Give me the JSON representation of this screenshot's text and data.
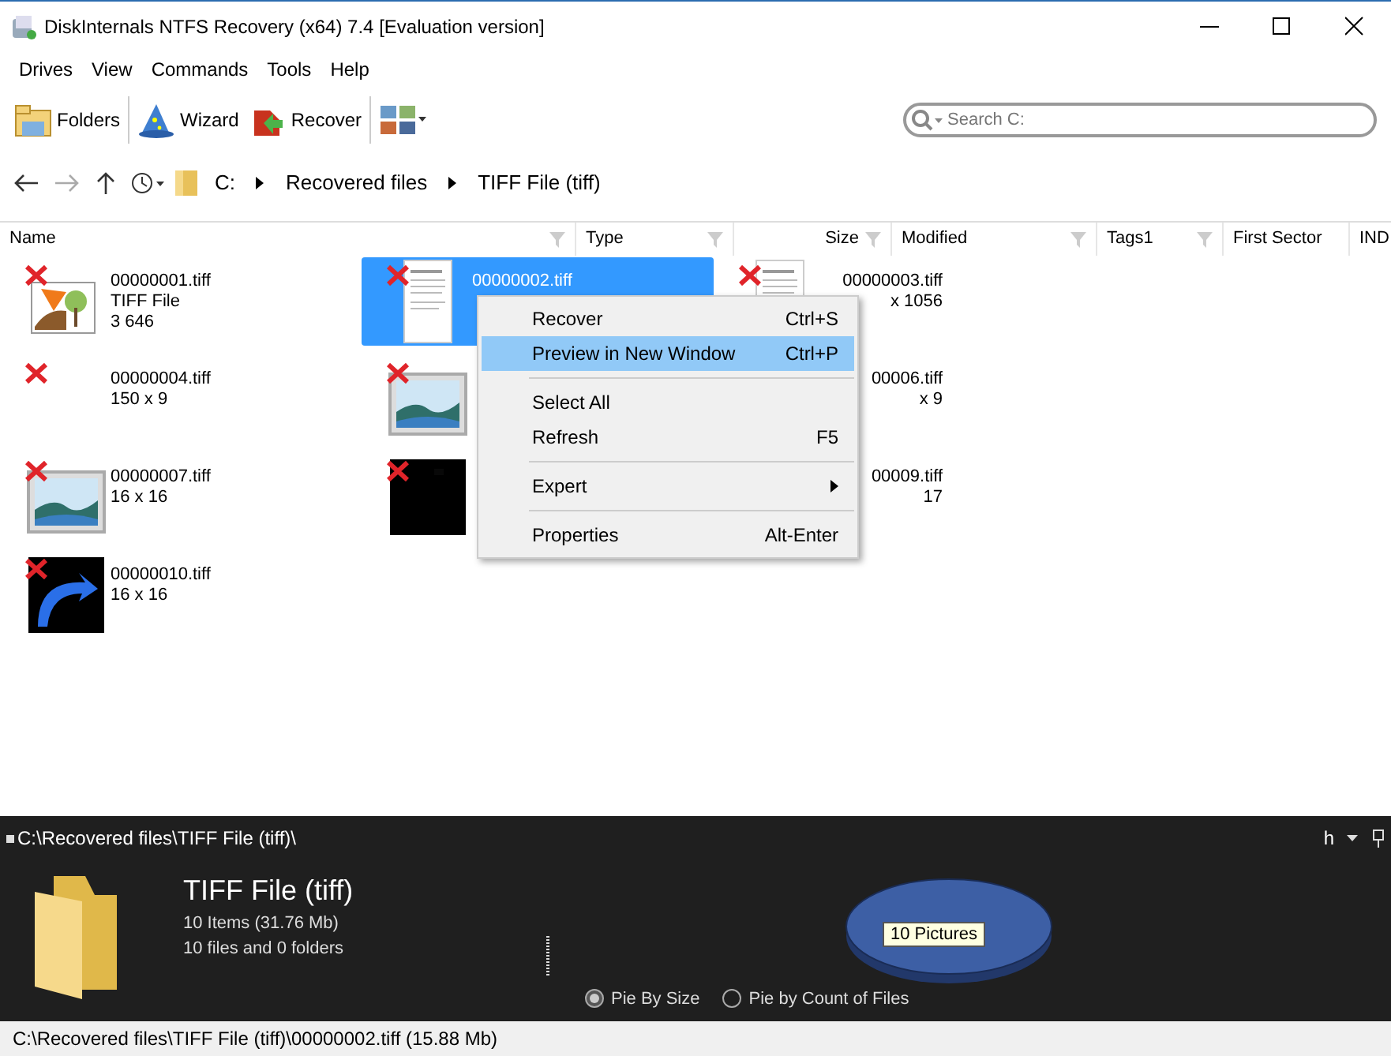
{
  "window": {
    "title": "DiskInternals NTFS Recovery (x64) 7.4 [Evaluation version]"
  },
  "menu_bar": [
    "Drives",
    "View",
    "Commands",
    "Tools",
    "Help"
  ],
  "toolbar": [
    {
      "label": "Folders",
      "kind": "folders"
    },
    {
      "label": "Wizard",
      "kind": "wizard"
    },
    {
      "label": "Recover",
      "kind": "recover"
    },
    {
      "kind": "view"
    }
  ],
  "search": {
    "placeholder": "Search C:"
  },
  "breadcrumb": [
    "C:",
    "Recovered files",
    "TIFF File (tiff)"
  ],
  "columns": [
    {
      "label": "Name",
      "filter": true
    },
    {
      "label": "Type",
      "filter": true
    },
    {
      "label": "Size",
      "filter": true
    },
    {
      "label": "Modified",
      "filter": true
    },
    {
      "label": "Tags1",
      "filter": true
    },
    {
      "label": "First Sector",
      "filter": false
    },
    {
      "label": "IND",
      "filter": false
    }
  ],
  "files": [
    {
      "lines": [
        "00000001.tiff",
        "TIFF File",
        "3 646"
      ],
      "kind": "drawing",
      "selected": false,
      "cut": false,
      "deleted": true
    },
    {
      "lines": [
        "00000002.tiff"
      ],
      "kind": "document",
      "selected": true,
      "cut": false,
      "deleted": true
    },
    {
      "lines": [
        "00000003.tiff",
        "x 1056"
      ],
      "kind": "document",
      "selected": false,
      "cut": true,
      "deleted": true
    },
    {
      "lines": [
        "00000004.tiff",
        "150 x 9"
      ],
      "kind": "blank",
      "selected": false,
      "cut": false,
      "deleted": true
    },
    {
      "kind": "landscape",
      "selected": false,
      "cut": false,
      "deleted": true
    },
    {
      "lines": [
        "00006.tiff",
        "x 9"
      ],
      "kind": "blank",
      "selected": false,
      "cut": true,
      "deleted": false
    },
    {
      "lines": [
        "00000007.tiff",
        "16 x 16"
      ],
      "kind": "landscape",
      "selected": false,
      "cut": false,
      "deleted": true
    },
    {
      "kind": "black",
      "selected": false,
      "cut": false,
      "deleted": true
    },
    {
      "lines": [
        "00009.tiff",
        "17"
      ],
      "kind": "blank",
      "selected": false,
      "cut": true,
      "deleted": false
    },
    {
      "lines": [
        "00000010.tiff",
        "16 x 16"
      ],
      "kind": "arrow",
      "selected": false,
      "cut": false,
      "deleted": true
    }
  ],
  "context_menu": [
    {
      "label": "Recover",
      "shortcut": "Ctrl+S",
      "selected": false,
      "kind": "item"
    },
    {
      "label": "Preview in New Window",
      "shortcut": "Ctrl+P",
      "selected": true,
      "kind": "item"
    },
    {
      "kind": "separator"
    },
    {
      "label": "Select All",
      "selected": false,
      "kind": "item"
    },
    {
      "label": "Refresh",
      "shortcut": "F5",
      "selected": false,
      "kind": "item"
    },
    {
      "kind": "separator"
    },
    {
      "label": "Expert",
      "selected": false,
      "kind": "submenu"
    },
    {
      "kind": "separator"
    },
    {
      "label": "Properties",
      "shortcut": "Alt-Enter",
      "selected": false,
      "kind": "item"
    }
  ],
  "info_panel": {
    "path": "C:\\Recovered files\\TIFF File (tiff)\\",
    "header_button": "h",
    "title": "TIFF File (tiff)",
    "details": [
      "10 Items (31.76 Mb)",
      "10 files and 0 folders"
    ],
    "pie_label": "10 Pictures",
    "options": [
      {
        "label": "Pie By Size",
        "selected": true
      },
      {
        "label": "Pie by Count of Files",
        "selected": false
      }
    ]
  },
  "status_bar": "C:\\Recovered files\\TIFF File (tiff)\\00000002.tiff (15.88 Mb)"
}
